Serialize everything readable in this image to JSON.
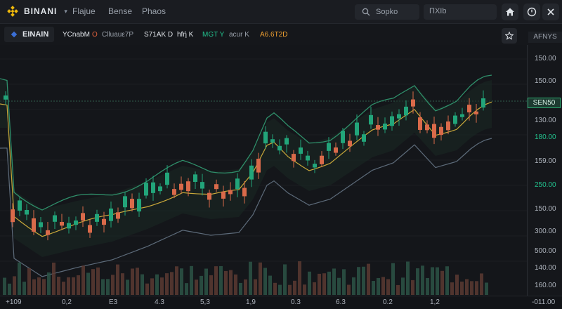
{
  "header": {
    "brand": "BINANI",
    "nav": [
      "Flajue",
      "Bense",
      "Phaos"
    ],
    "search_placeholder": "Sopko",
    "search2_text": "ΠΧΙb",
    "icons": [
      "home-icon",
      "clock-icon",
      "close-icon"
    ]
  },
  "subbar": {
    "pair": "EINAIN",
    "indicators": [
      {
        "text": "YCnabM",
        "color": "#dfe3e8"
      },
      {
        "text": "O",
        "color": "#e0603b"
      },
      {
        "text": "Clluauε7P",
        "color": "#9aa1ab"
      },
      {
        "text": "S71AK D",
        "color": "#dfe3e8"
      },
      {
        "text": "hfή K",
        "color": "#dfe3e8"
      },
      {
        "text": "MGT Y",
        "color": "#22c38e"
      },
      {
        "text": "acur K",
        "color": "#9aa1ab"
      },
      {
        "text": "A6.6T2D",
        "color": "#f0a030"
      }
    ],
    "alerts": "AFNYS"
  },
  "price_axis": {
    "labels": [
      {
        "text": "150.00",
        "kind": "plain"
      },
      {
        "text": "150.00",
        "kind": "plain"
      },
      {
        "text": "130.00",
        "kind": "plain"
      },
      {
        "text": "180.00",
        "kind": "green"
      },
      {
        "text": "159.00",
        "kind": "plain"
      },
      {
        "text": "250.00",
        "kind": "green"
      },
      {
        "text": "150.00",
        "kind": "plain"
      },
      {
        "text": "300.00",
        "kind": "plain"
      },
      {
        "text": "500.00",
        "kind": "plain"
      },
      {
        "text": "140.00",
        "kind": "plain"
      },
      {
        "text": "160.00",
        "kind": "plain"
      }
    ],
    "current_tag": "SEN50"
  },
  "time_axis": {
    "labels": [
      "+109",
      "0,2",
      "E3",
      "4.3",
      "5,3",
      "1,9",
      "0.3",
      "6.3",
      "0.2",
      "1,2"
    ],
    "right_label": "-011.00"
  },
  "colors": {
    "up": "#22a57a",
    "down": "#d96a4a",
    "ma_yellow": "#c9a83a",
    "ma_green": "#2f8f6a",
    "ma_gray": "#6f7d8c",
    "bg": "#14161a"
  }
}
